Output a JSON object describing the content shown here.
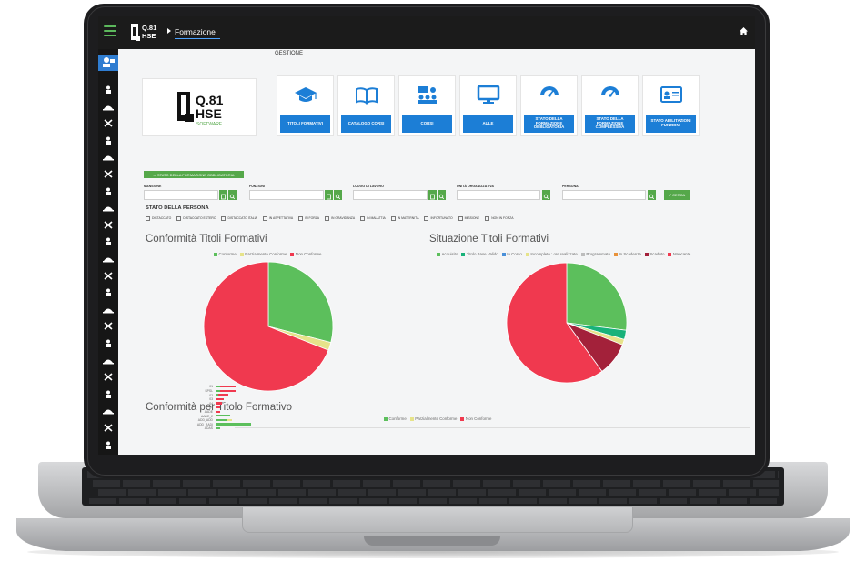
{
  "app": {
    "breadcrumb": "Formazione",
    "section_title": "GESTIONE",
    "logo_line1": "Q.81",
    "logo_line2": "HSE",
    "logo_line3": "SOFTWARE",
    "top_logo_line1": "Q.81",
    "top_logo_line2": "HSE"
  },
  "tiles": [
    {
      "label": "TITOLI FORMATIVI",
      "icon": "graduation-cap-icon"
    },
    {
      "label": "CATALOGO CORSI",
      "icon": "open-book-icon"
    },
    {
      "label": "CORSI",
      "icon": "classroom-icon"
    },
    {
      "label": "AULE",
      "icon": "monitor-icon"
    },
    {
      "label": "STATO DELLA FORMAZIONE OBBLIGATORIA",
      "icon": "gauge-icon"
    },
    {
      "label": "STATO DELLA FORMAZIONE COMPLESSIVA",
      "icon": "gauge-icon"
    },
    {
      "label": "STATO ABILITAZIONI FUNZIONI",
      "icon": "id-card-icon"
    }
  ],
  "filters": {
    "stato_button": "STATO DELLA FORMAZIONE OBBLIGATORIA",
    "mansione": "MANSIONE",
    "funzioni": "FUNZIONI",
    "luogo": "LUOGO DI LAVORO",
    "unita": "UNITÀ ORGANIZZATIVA",
    "persona": "PERSONA",
    "cerca": "CERCA"
  },
  "stato_persona": {
    "title": "STATO DELLA PERSONA",
    "options": [
      "DISTACCATO",
      "DISTACCATO ESTERO",
      "DISTACCATO ITALIA",
      "IN ASPETTATIVA",
      "IN FORZA",
      "IN GRAVIDANZA",
      "IN MALATTIA",
      "IN MATERNITÀ",
      "INFORTUNATO",
      "MISSIONE",
      "NON IN FORZA"
    ]
  },
  "colors": {
    "conforme": "#5cbf5c",
    "parziale": "#e6e38a",
    "non_conforme": "#f0394f",
    "acquisito": "#5cbf5c",
    "titolo_base": "#18b27a",
    "in_corso": "#4a90d9",
    "incompleto": "#e6e38a",
    "programmato": "#bdbdbd",
    "in_scadenza": "#e8923a",
    "scaduto": "#a3213a",
    "mancante": "#f0394f",
    "primary": "#1c7ed6",
    "success": "#55a84a"
  },
  "chart_data": [
    {
      "type": "pie",
      "title": "Conformità Titoli Formativi",
      "categories": [
        "Conforme",
        "Parzialmente Conforme",
        "Non Conforme"
      ],
      "values": [
        29,
        2,
        69
      ]
    },
    {
      "type": "pie",
      "title": "Situazione Titoli Formativi",
      "categories": [
        "Acquisito",
        "Titolo Base Valido",
        "In Corso",
        "Incompleto : ore realizzate",
        "Programmato",
        "In Scadenza",
        "Scaduto",
        "Mancante"
      ],
      "values": [
        27,
        2.5,
        0,
        1.5,
        0,
        0,
        9,
        60
      ]
    },
    {
      "type": "bar",
      "title": "Conformità per Titolo Formativo",
      "legend": [
        "Conforme",
        "Parzialmente Conforme",
        "Non Conforme"
      ],
      "categories": [
        "01",
        "SPSL",
        "02",
        "03",
        "04",
        "05",
        "AADE",
        "AADE_2",
        "ADD_ADD",
        "ADD_RADI",
        "ADAS"
      ],
      "series": [
        {
          "name": "Conforme",
          "values": [
            2,
            2,
            1,
            0,
            0,
            0,
            0,
            7,
            5,
            18,
            2
          ]
        },
        {
          "name": "Parzialmente Conforme",
          "values": [
            0,
            0,
            0,
            0,
            0,
            0,
            0,
            0,
            3,
            0,
            0
          ]
        },
        {
          "name": "Non Conforme",
          "values": [
            8,
            8,
            5,
            4,
            3,
            2,
            2,
            0,
            0,
            0,
            0
          ]
        }
      ]
    }
  ]
}
